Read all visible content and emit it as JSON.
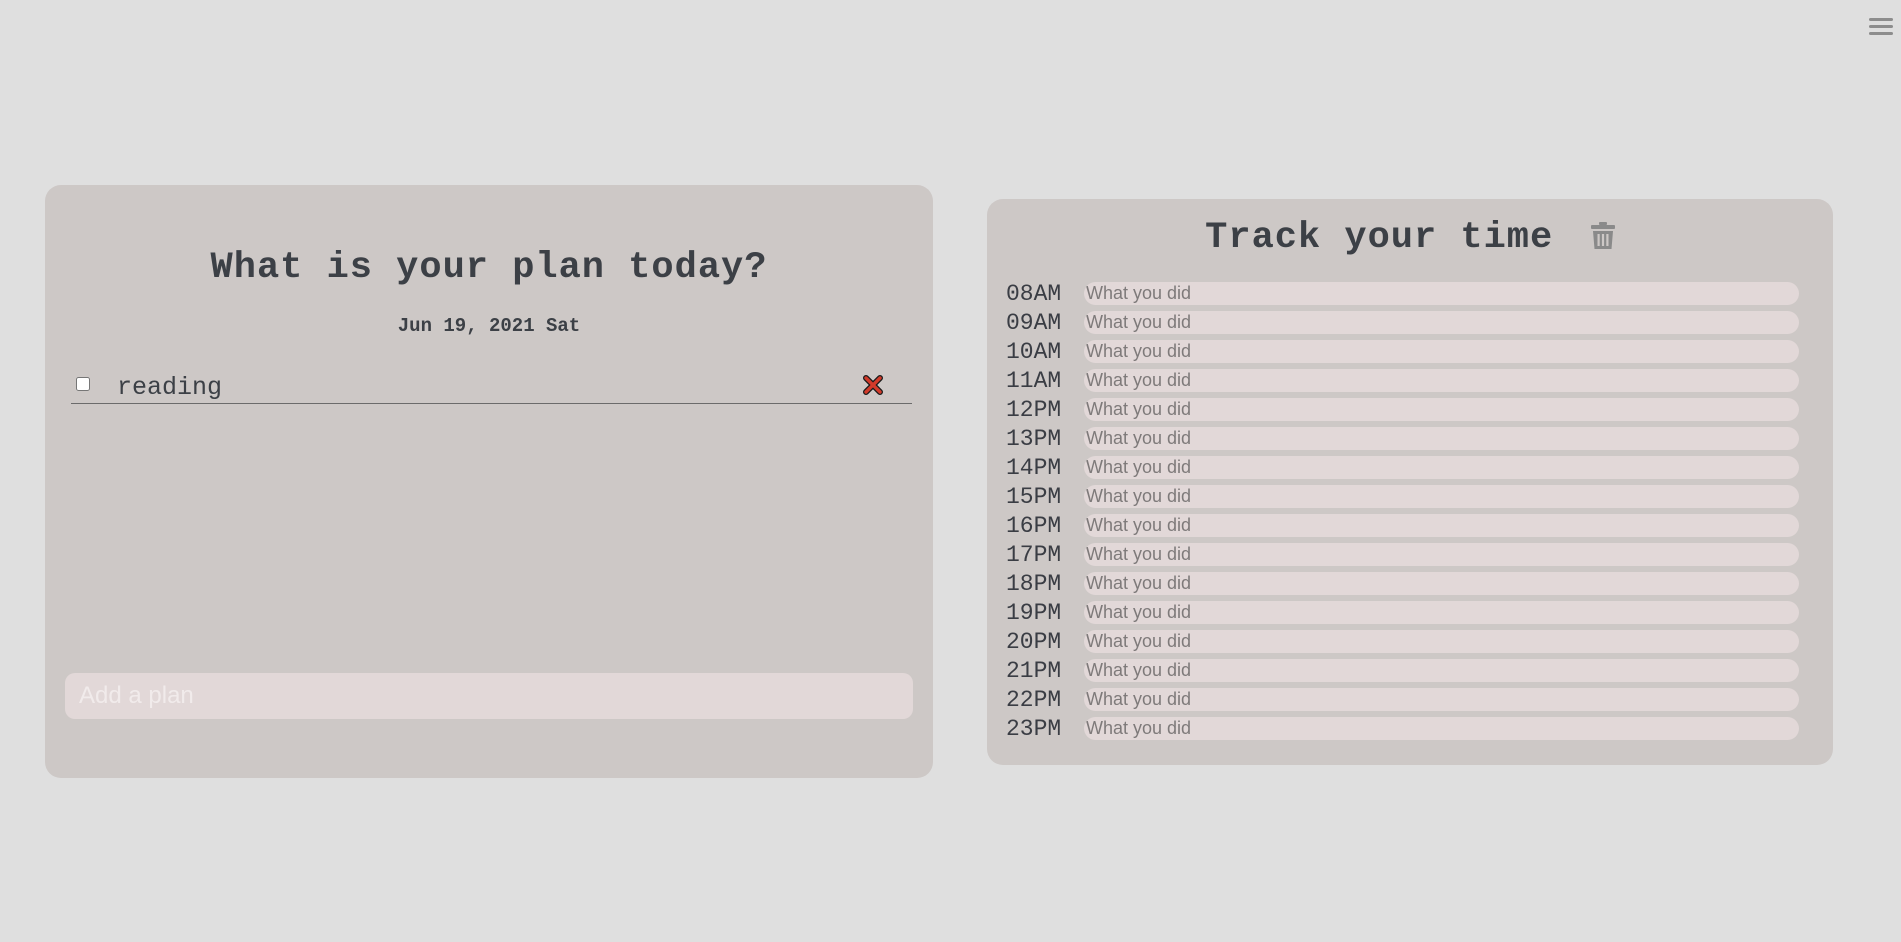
{
  "menu": {
    "icon": "hamburger-menu-icon"
  },
  "planner": {
    "title": "What is your plan today?",
    "date": "Jun 19, 2021 Sat",
    "items": [
      {
        "text": "reading",
        "checked": false,
        "delete_icon": "red-x-icon"
      }
    ],
    "add_placeholder": "Add a plan",
    "delete_color": "#c0392b"
  },
  "tracker": {
    "title": "Track your time",
    "trash_icon": "trash-icon",
    "placeholder": "What you did",
    "hours": [
      {
        "label": "08AM"
      },
      {
        "label": "09AM"
      },
      {
        "label": "10AM"
      },
      {
        "label": "11AM"
      },
      {
        "label": "12PM"
      },
      {
        "label": "13PM"
      },
      {
        "label": "14PM"
      },
      {
        "label": "15PM"
      },
      {
        "label": "16PM"
      },
      {
        "label": "17PM"
      },
      {
        "label": "18PM"
      },
      {
        "label": "19PM"
      },
      {
        "label": "20PM"
      },
      {
        "label": "21PM"
      },
      {
        "label": "22PM"
      },
      {
        "label": "23PM"
      }
    ]
  },
  "colors": {
    "background": "#dfdfdf",
    "panel": "#cdc8c6",
    "input": "#e2d8d8",
    "text": "#3c4046"
  }
}
